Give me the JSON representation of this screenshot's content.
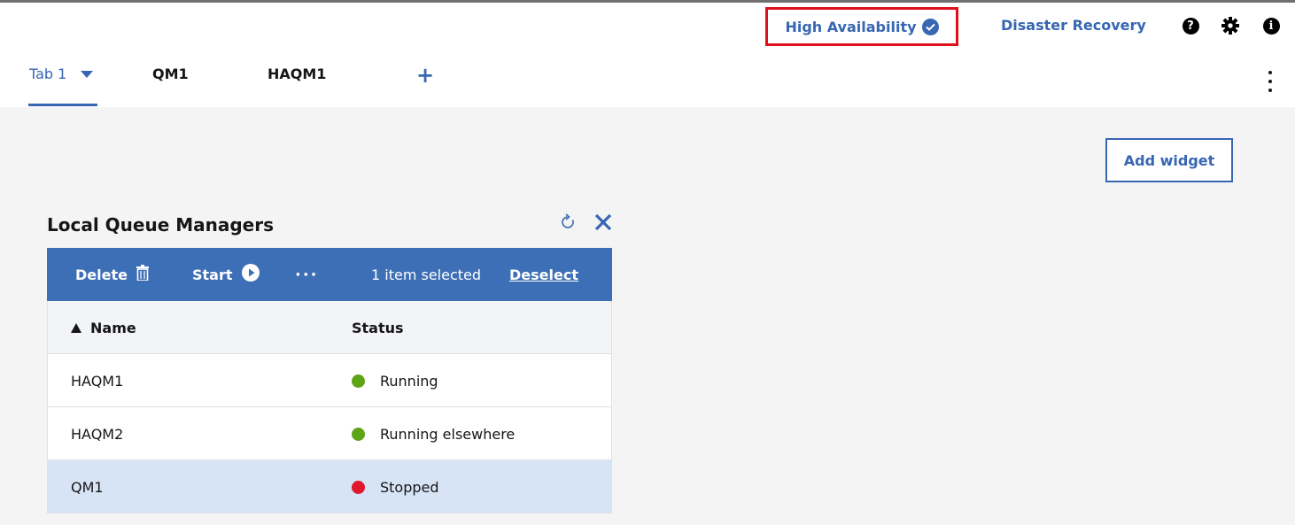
{
  "header": {
    "high_availability": "High Availability",
    "disaster_recovery": "Disaster Recovery",
    "icons": [
      "help-icon",
      "settings-gear-icon",
      "info-icon"
    ],
    "accent_color": "#3766b2",
    "highlight_color": "#e0101a"
  },
  "tabs": [
    {
      "label": "Tab 1",
      "active": true
    },
    {
      "label": "QM1"
    },
    {
      "label": "HAQM1"
    }
  ],
  "add_tab": "+",
  "add_widget_label": "Add widget",
  "widget": {
    "title": "Local Queue Managers",
    "toolbar": {
      "delete_label": "Delete",
      "start_label": "Start",
      "more_label": "···",
      "selection_text": "1 item selected",
      "deselect_label": "Deselect"
    },
    "columns": [
      "Name",
      "Status"
    ],
    "rows": [
      {
        "name": "HAQM1",
        "status": "Running",
        "status_color": "#5fa317",
        "selected": false
      },
      {
        "name": "HAQM2",
        "status": "Running elsewhere",
        "status_color": "#5fa317",
        "selected": false
      },
      {
        "name": "QM1",
        "status": "Stopped",
        "status_color": "#e0182d",
        "selected": true
      }
    ]
  }
}
